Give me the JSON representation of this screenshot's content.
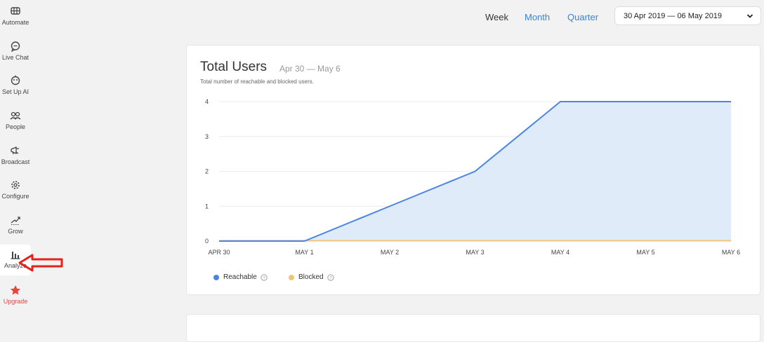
{
  "sidebar": {
    "items": [
      {
        "label": "Automate",
        "icon": "automate-icon"
      },
      {
        "label": "Live Chat",
        "icon": "chat-bubble-icon"
      },
      {
        "label": "Set Up AI",
        "icon": "ai-icon"
      },
      {
        "label": "People",
        "icon": "people-icon"
      },
      {
        "label": "Broadcast",
        "icon": "megaphone-icon"
      },
      {
        "label": "Configure",
        "icon": "gear-icon"
      },
      {
        "label": "Grow",
        "icon": "grow-icon"
      },
      {
        "label": "Analyze",
        "icon": "bar-chart-icon",
        "active": true
      },
      {
        "label": "Upgrade",
        "icon": "star-icon",
        "color": "#e8453c"
      }
    ]
  },
  "topbar": {
    "periods": [
      "Week",
      "Month",
      "Quarter"
    ],
    "date_range": "30 Apr 2019 — 06 May 2019"
  },
  "card": {
    "title": "Total Users",
    "range": "Apr 30 — May 6",
    "description": "Total number of reachable and blocked users."
  },
  "colors": {
    "reachable": "#4a86e0",
    "blocked": "#f5c27a",
    "area": "#e0ebf9",
    "accent": "#3b82d6",
    "annotation": "#e8201c"
  },
  "chart_data": {
    "type": "area",
    "categories": [
      "APR 30",
      "MAY 1",
      "MAY 2",
      "MAY 3",
      "MAY 4",
      "MAY 5",
      "MAY 6"
    ],
    "series": [
      {
        "name": "Reachable",
        "values": [
          0,
          0,
          1,
          2,
          4,
          4,
          4
        ]
      },
      {
        "name": "Blocked",
        "values": [
          0,
          0,
          0,
          0,
          0,
          0,
          0
        ]
      }
    ],
    "yticks": [
      "0",
      "1",
      "2",
      "3",
      "4"
    ],
    "ylim": [
      0,
      4
    ],
    "grid": true,
    "legend": "bottom-left"
  }
}
